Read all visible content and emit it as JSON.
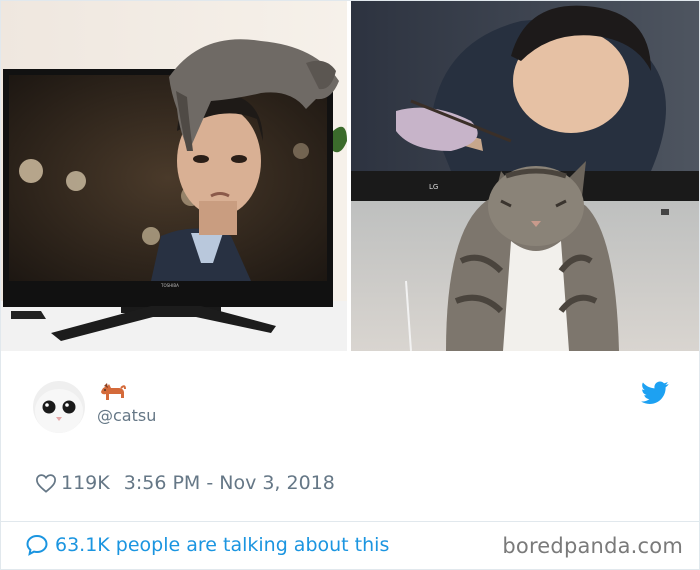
{
  "tweet": {
    "handle": "@catsu",
    "likes": "119K",
    "timestamp": "3:56 PM - Nov 3, 2018",
    "emoji_icon": "dog-emoji-icon"
  },
  "footer": {
    "talking": "63.1K people are talking about this",
    "brand": "boredpanda.com"
  },
  "colors": {
    "accent": "#1da1f2",
    "link": "#1b95e0",
    "muted": "#657786"
  },
  "photos": {
    "left_tv_brand": "TOSHIBA",
    "right_tv_brand": "LG"
  }
}
